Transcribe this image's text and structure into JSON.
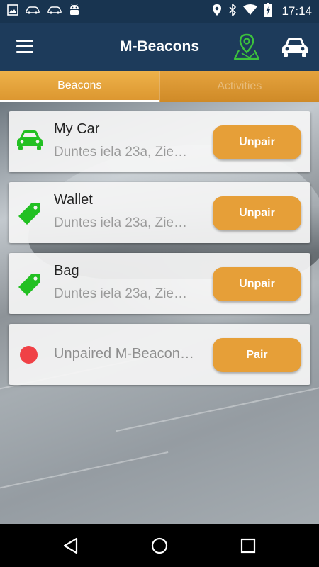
{
  "status_bar": {
    "time": "17:14",
    "left_icons": [
      "image-icon",
      "car-icon",
      "car-icon",
      "android-icon"
    ],
    "right_icons": [
      "location-icon",
      "bluetooth-icon",
      "wifi-icon",
      "battery-charging-icon"
    ]
  },
  "app_bar": {
    "title": "M-Beacons",
    "icons": [
      "menu-icon",
      "map-pin-icon",
      "car-icon"
    ],
    "map_icon_color": "#3cc23c"
  },
  "tabs": [
    {
      "label": "Beacons",
      "active": true
    },
    {
      "label": "Activities",
      "active": false
    }
  ],
  "beacons": [
    {
      "name": "My Car",
      "address": "Duntes iela 23a, Zie…",
      "icon": "car-icon",
      "button": "Unpair"
    },
    {
      "name": "Wallet",
      "address": "Duntes iela 23a, Zie…",
      "icon": "tag-icon",
      "button": "Unpair"
    },
    {
      "name": "Bag",
      "address": "Duntes iela 23a, Zie…",
      "icon": "tag-icon",
      "button": "Unpair"
    },
    {
      "name": "Unpaired M-Beacon…",
      "icon": "red-dot-icon",
      "button": "Pair"
    }
  ],
  "colors": {
    "app_bar": "#1d3b5b",
    "accent_orange": "#e69f38",
    "icon_green": "#22c022",
    "unpaired_red": "#f04146"
  },
  "nav_bar": [
    "back-icon",
    "home-icon",
    "recents-icon"
  ]
}
